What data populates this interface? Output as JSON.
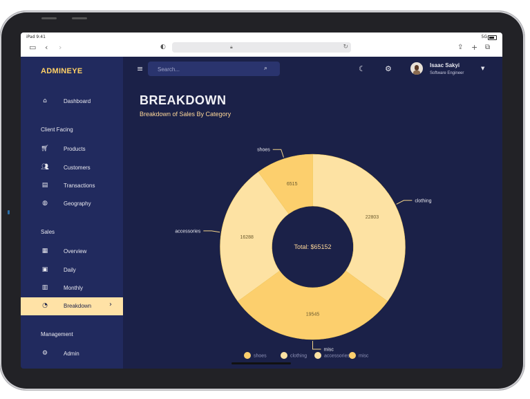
{
  "status_bar": {
    "time": "iPad 9:41",
    "signal": "5G"
  },
  "browser": {
    "url_lock_icon": "lock-icon",
    "icons": [
      "sidebar-icon",
      "back-icon",
      "forward-icon",
      "shield-icon",
      "share-icon",
      "new-tab-icon",
      "tabs-icon",
      "reload-icon"
    ]
  },
  "sidebar": {
    "brand": "ADMINEYE",
    "sections": {
      "client": "Client Facing",
      "sales": "Sales",
      "management": "Management"
    },
    "items": [
      {
        "label": "Dashboard",
        "icon": "home-icon"
      },
      {
        "label": "Products",
        "icon": "cart-icon"
      },
      {
        "label": "Customers",
        "icon": "people-icon"
      },
      {
        "label": "Transactions",
        "icon": "receipt-icon"
      },
      {
        "label": "Geography",
        "icon": "globe-icon"
      },
      {
        "label": "Overview",
        "icon": "chart-overview-icon"
      },
      {
        "label": "Daily",
        "icon": "calendar-day-icon"
      },
      {
        "label": "Monthly",
        "icon": "calendar-month-icon"
      },
      {
        "label": "Breakdown",
        "icon": "pie-chart-icon",
        "active": true
      },
      {
        "label": "Admin",
        "icon": "admin-icon"
      }
    ]
  },
  "topbar": {
    "search_placeholder": "Search...",
    "user_name": "Isaac Sakyi",
    "user_role": "Software Engineer"
  },
  "page": {
    "title": "BREAKDOWN",
    "subtitle": "Breakdown of Sales By Category"
  },
  "colors": {
    "accent": "#ffd166",
    "background": "#1b2148",
    "sidebar": "#212a5e",
    "active": "#ffe2a6"
  },
  "chart_data": {
    "type": "pie",
    "donut": true,
    "center_label": "Total: $65152",
    "slices": [
      {
        "name": "clothing",
        "value": 22803,
        "color": "#fde2a3"
      },
      {
        "name": "misc",
        "value": 19545,
        "color": "#fccf6d"
      },
      {
        "name": "accessories",
        "value": 16288,
        "color": "#fde2a3"
      },
      {
        "name": "shoes",
        "value": 6515,
        "color": "#fccf6d"
      }
    ],
    "legend": {
      "placement": "bottom",
      "entries": [
        {
          "name": "shoes",
          "color": "#fccf6d"
        },
        {
          "name": "clothing",
          "color": "#fde2a3"
        },
        {
          "name": "accessories",
          "color": "#fde2a3"
        },
        {
          "name": "misc",
          "color": "#fccf6d"
        }
      ]
    }
  }
}
